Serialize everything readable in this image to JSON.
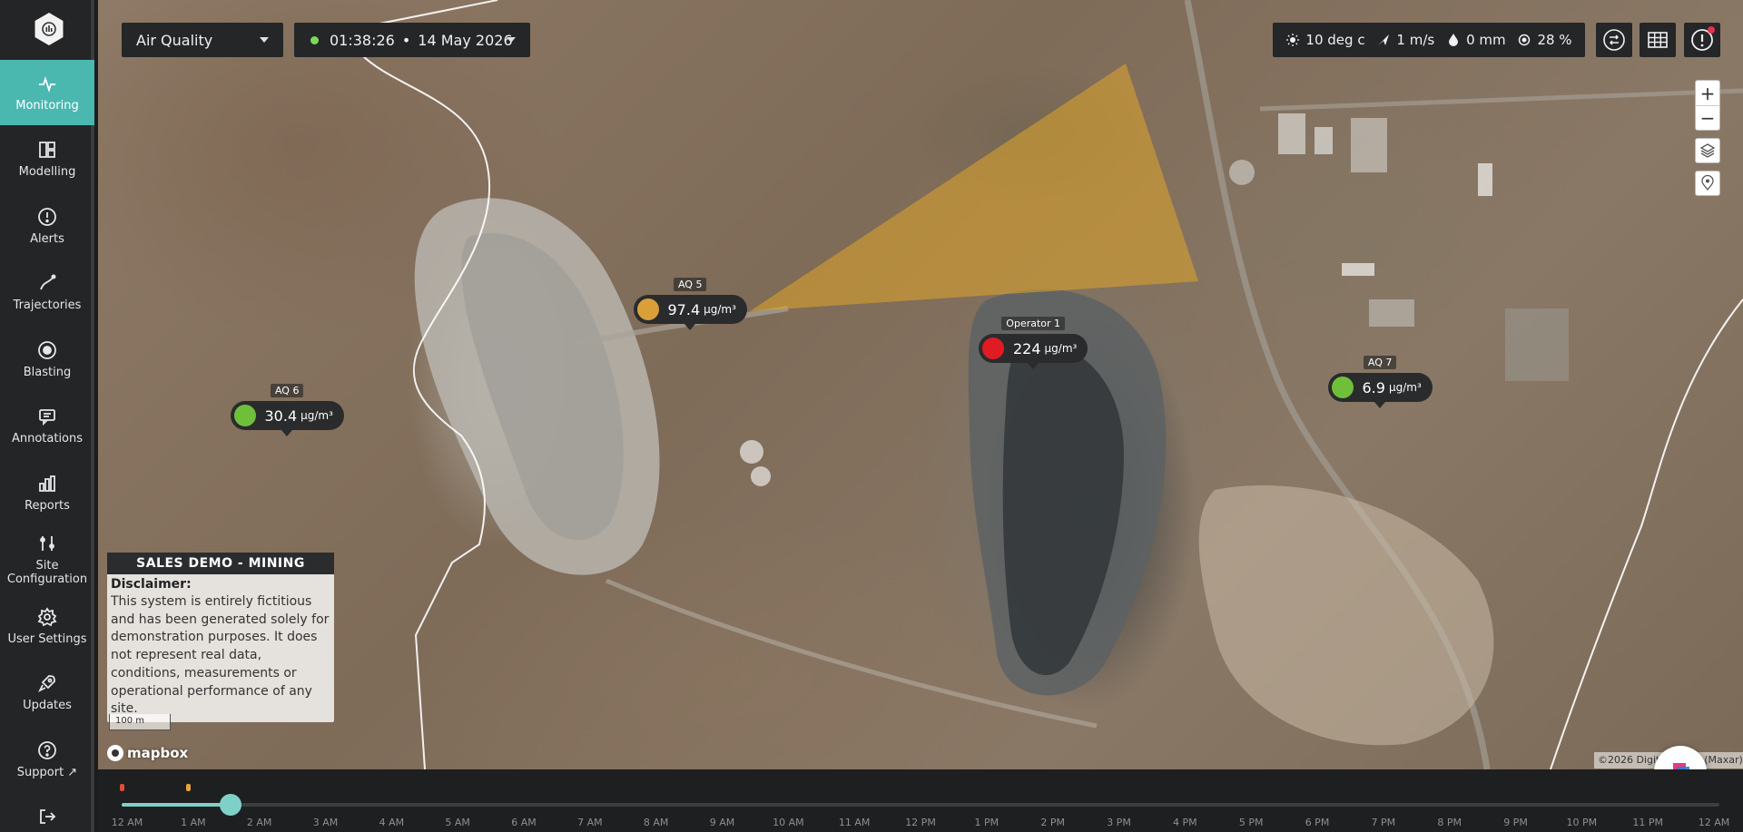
{
  "sidebar": {
    "items": [
      {
        "key": "monitoring",
        "label": "Monitoring",
        "icon": "pulse-icon",
        "active": true
      },
      {
        "key": "modelling",
        "label": "Modelling",
        "icon": "layout-icon",
        "active": false
      },
      {
        "key": "alerts",
        "label": "Alerts",
        "icon": "alert-circle-icon",
        "active": false
      },
      {
        "key": "trajectories",
        "label": "Trajectories",
        "icon": "trajectory-icon",
        "active": false
      },
      {
        "key": "blasting",
        "label": "Blasting",
        "icon": "target-icon",
        "active": false
      },
      {
        "key": "annotations",
        "label": "Annotations",
        "icon": "comment-icon",
        "active": false
      },
      {
        "key": "reports",
        "label": "Reports",
        "icon": "bar-chart-icon",
        "active": false
      },
      {
        "key": "site-configuration",
        "label": "Site\nConfiguration",
        "icon": "sliders-icon",
        "active": false
      },
      {
        "key": "user-settings",
        "label": "User Settings",
        "icon": "gear-icon",
        "active": false
      },
      {
        "key": "updates",
        "label": "Updates",
        "icon": "rocket-icon",
        "active": false
      },
      {
        "key": "support",
        "label": "Support ↗",
        "icon": "help-circle-icon",
        "active": false
      },
      {
        "key": "logout",
        "label": "Logout",
        "icon": "logout-icon",
        "active": false
      }
    ]
  },
  "toolbar": {
    "layer": "Air Quality",
    "time": "01:38:26",
    "separator": "•",
    "date": "14 May 2026"
  },
  "weather": {
    "temperature": "10 deg c",
    "wind": "1 m/s",
    "rain": "0 mm",
    "humidity": "28 %"
  },
  "sensors": [
    {
      "name": "AQ 5",
      "value": "97.4",
      "unit": "µg/m³",
      "status_color": "#d9a03a"
    },
    {
      "name": "Operator 1",
      "value": "224",
      "unit": "µg/m³",
      "status_color": "#e01b24"
    },
    {
      "name": "AQ 6",
      "value": "30.4",
      "unit": "µg/m³",
      "status_color": "#6fbf3a"
    },
    {
      "name": "AQ 7",
      "value": "6.9",
      "unit": "µg/m³",
      "status_color": "#6fbf3a"
    }
  ],
  "disclaimer": {
    "title": "SALES DEMO - MINING",
    "subtitle": "Disclaimer:",
    "body": "This system is entirely fictitious and has been generated solely for demonstration purposes. It does not represent real data, conditions, measurements or operational performance of any site."
  },
  "map": {
    "scale_label": "100 m",
    "attribution": "©2026 Digital Globe (Maxar)",
    "provider": "mapbox",
    "plume_color": "#e0a52a"
  },
  "timeline": {
    "hours": [
      "12 AM",
      "1 AM",
      "2 AM",
      "3 AM",
      "4 AM",
      "5 AM",
      "6 AM",
      "7 AM",
      "8 AM",
      "9 AM",
      "10 AM",
      "11 AM",
      "12 PM",
      "1 PM",
      "2 PM",
      "3 PM",
      "4 PM",
      "5 PM",
      "6 PM",
      "7 PM",
      "8 PM",
      "9 PM",
      "10 PM",
      "11 PM",
      "12 AM"
    ],
    "current_fraction": 0.0683,
    "events": [
      {
        "fraction": 0.0,
        "color": "#e24a3b"
      },
      {
        "fraction": 0.0417,
        "color": "#e8a33a"
      }
    ]
  },
  "colors": {
    "accent": "#4bb8b0",
    "timeline_accent": "#7fd1c8"
  }
}
